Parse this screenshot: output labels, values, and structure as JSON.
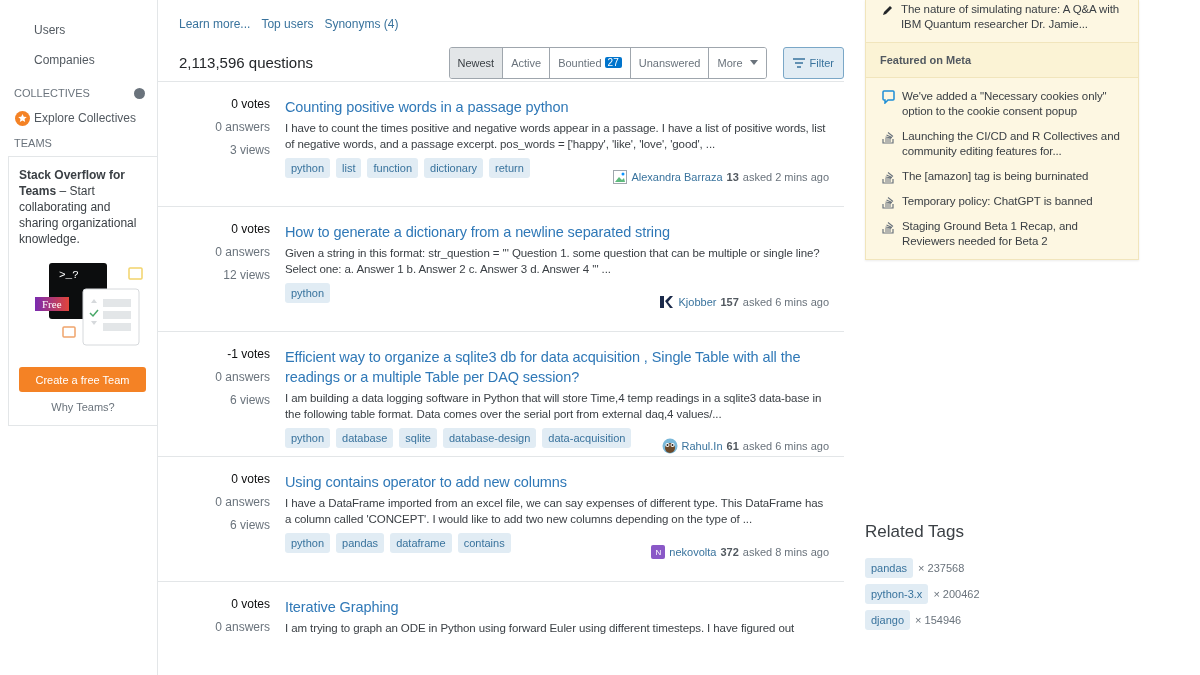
{
  "left_nav": {
    "items": [
      {
        "label": "Users",
        "selected": false
      },
      {
        "label": "Companies",
        "selected": false
      }
    ],
    "collectives": {
      "heading": "COLLECTIVES",
      "link": "Explore Collectives"
    },
    "teams": {
      "heading": "TEAMS",
      "title": "Stack Overflow for Teams",
      "text": " – Start collaborating and sharing organizational knowledge.",
      "terminal": ">_?",
      "badge": "Free",
      "button": "Create a free Team",
      "link": "Why Teams?"
    }
  },
  "tag_links": [
    "Learn more...",
    "Top users",
    "Synonyms (4)"
  ],
  "count": "2,113,596 questions",
  "sort_tabs": [
    {
      "label": "Newest",
      "selected": true
    },
    {
      "label": "Active",
      "selected": false
    },
    {
      "label": "Bountied",
      "badge": "27",
      "selected": false
    },
    {
      "label": "Unanswered",
      "selected": false
    },
    {
      "label": "More",
      "selected": false,
      "dropdown": true
    }
  ],
  "filter_button": "Filter",
  "questions": [
    {
      "votes": "0 votes",
      "answers": "0 answers",
      "views": "3 views",
      "title": "Counting positive words in a passage python",
      "excerpt": "I have to count the times positive and negative words appear in a passage. I have a list of positive words, list of negative words, and a passage excerpt. pos_words = ['happy', 'like', 'love', 'good', ...",
      "tags": [
        "python",
        "list",
        "function",
        "dictionary",
        "return"
      ],
      "avatar": {
        "kind": "broken"
      },
      "user": "Alexandra Barraza",
      "rep": "13",
      "time": "asked 2 mins ago"
    },
    {
      "votes": "0 votes",
      "answers": "0 answers",
      "views": "12 views",
      "title": "How to generate a dictionary from a newline separated string",
      "excerpt": "Given a string in this format: str_question = ''' Question 1. some question that can be multiple or single line? Select one: a. Answer 1 b. Answer 2 c. Answer 3 d. Answer 4 ''' ...",
      "tags": [
        "python"
      ],
      "avatar": {
        "kind": "logo"
      },
      "user": "Kjobber",
      "rep": "157",
      "time": "asked 6 mins ago"
    },
    {
      "votes": "-1 votes",
      "answers": "0 answers",
      "views": "6 views",
      "title": "Efficient way to organize a sqlite3 db for data acquisition , Single Table with all the readings or a multiple Table per DAQ session?",
      "excerpt": "I am building a data logging software in Python that will store Time,4 temp readings in a sqlite3 data-base in the following table format. Data comes over the serial port from external daq,4 values/...",
      "tags": [
        "python",
        "database",
        "sqlite",
        "database-design",
        "data-acquisition"
      ],
      "avatar": {
        "kind": "owl"
      },
      "user": "Rahul.In",
      "rep": "61",
      "time": "asked 6 mins ago"
    },
    {
      "votes": "0 votes",
      "answers": "0 answers",
      "views": "6 views",
      "title": "Using contains operator to add new columns",
      "excerpt": "I have a DataFrame imported from an excel file, we can say expenses of different type. This DataFrame has a column called 'CONCEPT'. I would like to add two new columns depending on the type of ...",
      "tags": [
        "python",
        "pandas",
        "dataframe",
        "contains"
      ],
      "avatar": {
        "kind": "letter",
        "text": "N"
      },
      "user": "nekovolta",
      "rep": "372",
      "time": "asked 8 mins ago"
    },
    {
      "votes": "0 votes",
      "answers": "0 answers",
      "title": "Iterative Graphing",
      "excerpt": "I am trying to graph an ODE in Python using forward Euler using different timesteps. I have figured out"
    }
  ],
  "blog_items": [
    {
      "kind": "pencil",
      "text": "The nature of simulating nature: A Q&A with IBM Quantum researcher Dr. Jamie..."
    }
  ],
  "meta": {
    "heading": "Featured on Meta",
    "items": [
      {
        "kind": "chat",
        "text": "We've added a \"Necessary cookies only\" option to the cookie consent popup"
      },
      {
        "kind": "stack",
        "text": "Launching the CI/CD and R Collectives and community editing features for..."
      },
      {
        "kind": "stack",
        "text": "The [amazon] tag is being burninated"
      },
      {
        "kind": "stack",
        "text": "Temporary policy: ChatGPT is banned"
      },
      {
        "kind": "stack",
        "text": "Staging Ground Beta 1 Recap, and Reviewers needed for Beta 2"
      }
    ]
  },
  "related_tags": {
    "heading": "Related Tags",
    "items": [
      {
        "tag": "pandas",
        "count": "× 237568"
      },
      {
        "tag": "python-3.x",
        "count": "× 200462"
      },
      {
        "tag": "django",
        "count": "× 154946"
      }
    ]
  }
}
